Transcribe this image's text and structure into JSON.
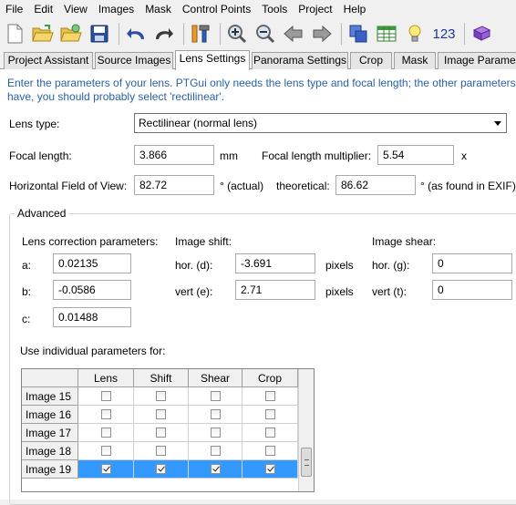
{
  "menu": [
    "File",
    "Edit",
    "View",
    "Images",
    "Mask",
    "Control Points",
    "Tools",
    "Project",
    "Help"
  ],
  "toolbar": {
    "icons": [
      "new-file-icon",
      "open-folder-icon",
      "open-recent-icon",
      "save-icon",
      "undo-icon",
      "redo-icon",
      "tools-icon",
      "zoom-in-icon",
      "zoom-out-icon",
      "previous-icon",
      "next-icon",
      "panorama-editor-icon",
      "table-icon",
      "tip-icon",
      "numbers-icon",
      "batch-icon"
    ],
    "numbers_label": "123"
  },
  "tabs": [
    "Project Assistant",
    "Source Images",
    "Lens Settings",
    "Panorama Settings",
    "Crop",
    "Mask",
    "Image Paramet"
  ],
  "active_tab": "Lens Settings",
  "intro": {
    "line1": "Enter the parameters of your lens. PTGui only needs the lens type and focal length; the other parameters w",
    "line2": "have, you should probably select 'rectilinear'."
  },
  "lens": {
    "type_label": "Lens type:",
    "type_value": "Rectilinear (normal lens)",
    "focal_label": "Focal length:",
    "focal_value": "3.866",
    "focal_unit": "mm",
    "multiplier_label": "Focal length multiplier:",
    "multiplier_value": "5.54",
    "multiplier_unit": "x",
    "hfov_label": "Horizontal Field of View:",
    "hfov_value": "82.72",
    "hfov_unit": "° (actual)",
    "theoretical_label": "theoretical:",
    "theoretical_value": "86.62",
    "theoretical_unit": "° (as found in EXIF)"
  },
  "advanced": {
    "title": "Advanced",
    "correction_label": "Lens correction parameters:",
    "a_label": "a:",
    "a_value": "0.02135",
    "b_label": "b:",
    "b_value": "-0.0586",
    "c_label": "c:",
    "c_value": "0.01488",
    "shift_label": "Image shift:",
    "hor_d_label": "hor. (d):",
    "hor_d_value": "-3.691",
    "vert_e_label": "vert (e):",
    "vert_e_value": "2.71",
    "pixels1": "pixels",
    "pixels2": "pixels",
    "shear_label": "Image shear:",
    "hor_g_label": "hor. (g):",
    "hor_g_value": "0",
    "vert_t_label": "vert (t):",
    "vert_t_value": "0",
    "individual_label": "Use individual parameters for:"
  },
  "grid": {
    "columns": [
      "Lens",
      "Shift",
      "Shear",
      "Crop"
    ],
    "rows": [
      {
        "name": "Image 15",
        "lens": false,
        "shift": false,
        "shear": false,
        "crop": false,
        "selected": false
      },
      {
        "name": "Image 16",
        "lens": false,
        "shift": false,
        "shear": false,
        "crop": false,
        "selected": false
      },
      {
        "name": "Image 17",
        "lens": false,
        "shift": false,
        "shear": false,
        "crop": false,
        "selected": false
      },
      {
        "name": "Image 18",
        "lens": false,
        "shift": false,
        "shear": false,
        "crop": false,
        "selected": false
      },
      {
        "name": "Image 19",
        "lens": true,
        "shift": true,
        "shear": true,
        "crop": true,
        "selected": true
      }
    ]
  },
  "colors": {
    "intro_text": "#2b5fa8",
    "selection": "#3399ff",
    "background": "#f0f0f0"
  }
}
